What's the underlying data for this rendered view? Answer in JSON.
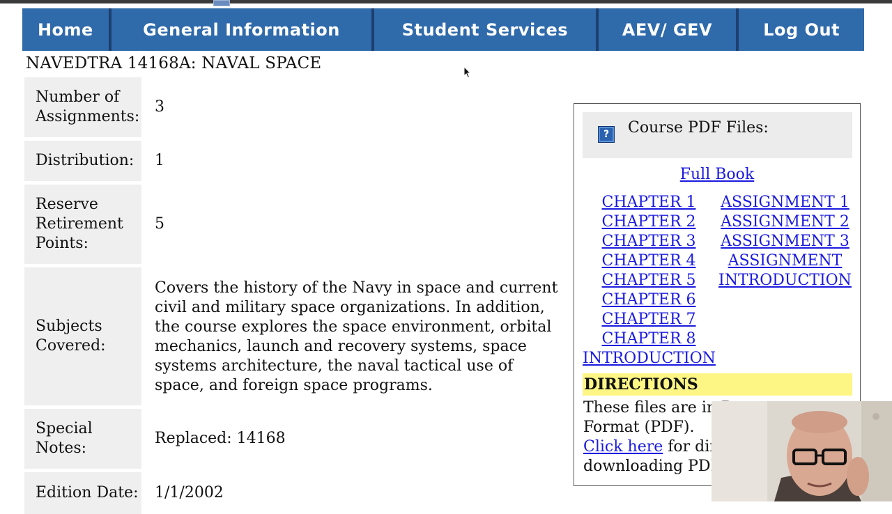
{
  "nav": {
    "items": [
      "Home",
      "General Information",
      "Student Services",
      "AEV/ GEV",
      "Log Out"
    ]
  },
  "page_title": "NAVEDTRA 14168A: NAVAL SPACE",
  "info": {
    "rows": [
      {
        "label": "Number of Assignments:",
        "value": "3"
      },
      {
        "label": "Distribution:",
        "value": "1"
      },
      {
        "label": "Reserve Retirement Points:",
        "value": "5"
      },
      {
        "label": "Subjects Covered:",
        "value": "Covers the history of the Navy in space and current civil and military space organizations. In addition, the course explores the space environment, orbital mechanics, launch and recovery systems, space systems architecture, the naval tactical use of space, and foreign space programs."
      },
      {
        "label": "Special Notes:",
        "value": "Replaced: 14168"
      },
      {
        "label": "Edition Date:",
        "value": "1/1/2002"
      }
    ]
  },
  "pdf_panel": {
    "heading": "Course PDF Files:",
    "full_book": "Full Book",
    "chapters": [
      "CHAPTER 1",
      "CHAPTER 2",
      "CHAPTER 3",
      "CHAPTER 4",
      "CHAPTER 5",
      "CHAPTER 6",
      "CHAPTER 7",
      "CHAPTER 8"
    ],
    "chapter_intro": "INTRODUCTION",
    "assignments": [
      "ASSIGNMENT 1",
      "ASSIGNMENT 2",
      "ASSIGNMENT 3",
      "ASSIGNMENT",
      "INTRODUCTION"
    ],
    "directions_title": "DIRECTIONS",
    "directions_line1": "These files are in P",
    "directions_line2": "Format (PDF).",
    "click_here": "Click here",
    "directions_line3_rest": " for dire",
    "directions_line4": "downloading PDF"
  },
  "icons": {
    "help": "help-icon",
    "cursor": "mouse-pointer-icon"
  },
  "colors": {
    "nav_bg": "#2f6aab",
    "nav_separator": "#1d3f6e",
    "label_bg": "#efefef",
    "link": "#1a1ae0",
    "directions_bg": "#fdf684"
  }
}
